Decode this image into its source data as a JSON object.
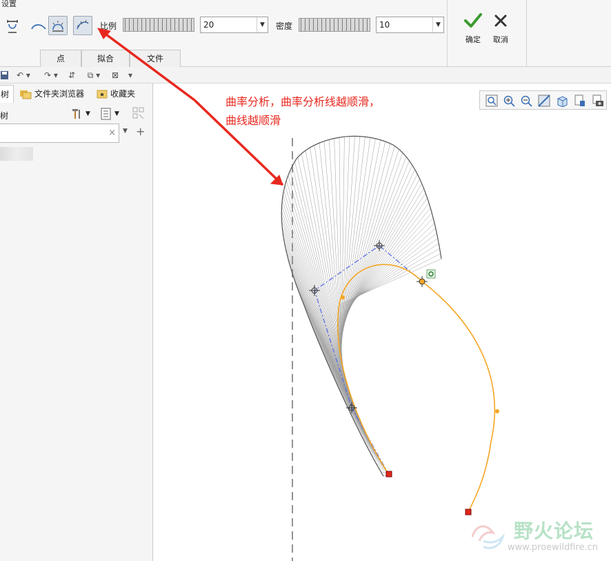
{
  "ribbon": {
    "settings_label": "设置",
    "scale_label": "比例",
    "scale_value": "20",
    "density_label": "密度",
    "density_value": "10",
    "ok_label": "确定",
    "cancel_label": "取消",
    "tabs": [
      {
        "label": "点"
      },
      {
        "label": "拟合"
      },
      {
        "label": "文件"
      }
    ]
  },
  "left_panel": {
    "tabs": [
      {
        "label": "树"
      },
      {
        "label": "文件夹浏览器"
      },
      {
        "label": "收藏夹"
      }
    ],
    "tree_label": "树",
    "search_value": ""
  },
  "annotation": {
    "line1": "曲率分析，曲率分析线越顺滑，",
    "line2": "曲线越顺滑"
  },
  "watermark": {
    "text": "野火论坛",
    "url": "www.proewildfire.cn"
  },
  "colors": {
    "curve": "#f5a623",
    "control_polygon": "#5b6ee1",
    "comb": "#9a9a9a",
    "annotation": "#e8281e",
    "endpoint": "#e2261a"
  },
  "icons": [
    "ruler-icon",
    "curve-icon",
    "comb-icon",
    "curvature-icon",
    "check-icon",
    "close-icon",
    "save-icon",
    "undo-icon",
    "redo-icon",
    "regenerate-icon",
    "window-icon",
    "close-window-icon",
    "tools-icon",
    "settings-list-icon",
    "filter-icon",
    "add-icon",
    "zoom-fit-icon",
    "zoom-in-icon",
    "zoom-out-icon",
    "view-icon",
    "cube-icon",
    "saved-view-icon",
    "camera-icon"
  ]
}
